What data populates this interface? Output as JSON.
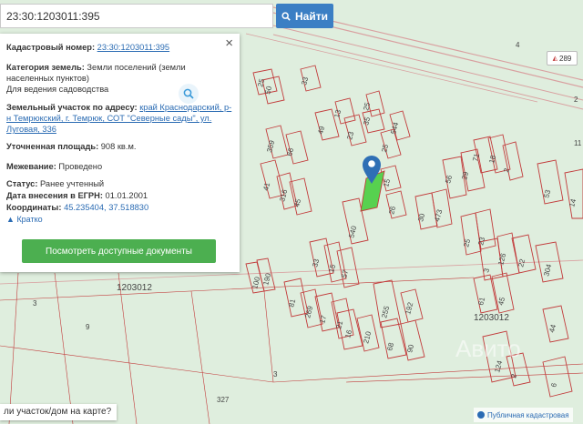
{
  "search": {
    "value": "23:30:1203011:395",
    "button_label": "Найти"
  },
  "info": {
    "cadastral_label": "Кадастровый номер:",
    "cadastral_value": "23:30:1203011:395",
    "category_label": "Категория земель:",
    "category_value": "Земли поселений (земли населенных пунктов)",
    "usage_value": "Для ведения садоводства",
    "address_label": "Земельный участок по адресу:",
    "address_value": "край Краснодарский, р-н Темрюкский, г. Темрюк, СОТ \"Северные сады\", ул. Луговая, 336",
    "area_label": "Уточненная площадь:",
    "area_value": "908 кв.м.",
    "survey_label": "Межевание:",
    "survey_value": "Проведено",
    "status_label": "Статус:",
    "status_value": "Ранее учтенный",
    "egrn_label": "Дата внесения в ЕГРН:",
    "egrn_value": "01.01.2001",
    "coords_label": "Координаты:",
    "coords_value": "45.235404, 37.518830",
    "toggle_label": "Кратко",
    "docs_button": "Посмотреть доступные документы",
    "close_glyph": "×"
  },
  "map": {
    "quarter_labels": [
      "1203012",
      "1203012"
    ],
    "parcel_labels": [
      "25",
      "50",
      "33",
      "13",
      "25",
      "35",
      "359",
      "66",
      "49",
      "23",
      "25",
      "544",
      "41",
      "316",
      "45",
      "56",
      "29",
      "15",
      "26",
      "30",
      "473",
      "71",
      "18",
      "2",
      "540",
      "25",
      "23",
      "53",
      "14",
      "33",
      "15",
      "57",
      "3",
      "126",
      "22",
      "304",
      "100",
      "190",
      "81",
      "269",
      "17",
      "21",
      "255",
      "192",
      "16",
      "210",
      "68",
      "90",
      "61",
      "45",
      "44",
      "124",
      "2",
      "6",
      "3",
      "9",
      "327",
      "4",
      "2",
      "11",
      "3"
    ],
    "road_badge": "289",
    "watermark": "Авито",
    "attribution": "Публичная кадастровая",
    "colors": {
      "background": "#dfeede",
      "parcel_stroke": "#c23b3b",
      "selected_fill": "#57d14f",
      "road": "#d9a0a0",
      "marker": "#2f6fb5"
    }
  },
  "bottom_bar": {
    "text": "ли участок/дом на карте?"
  }
}
